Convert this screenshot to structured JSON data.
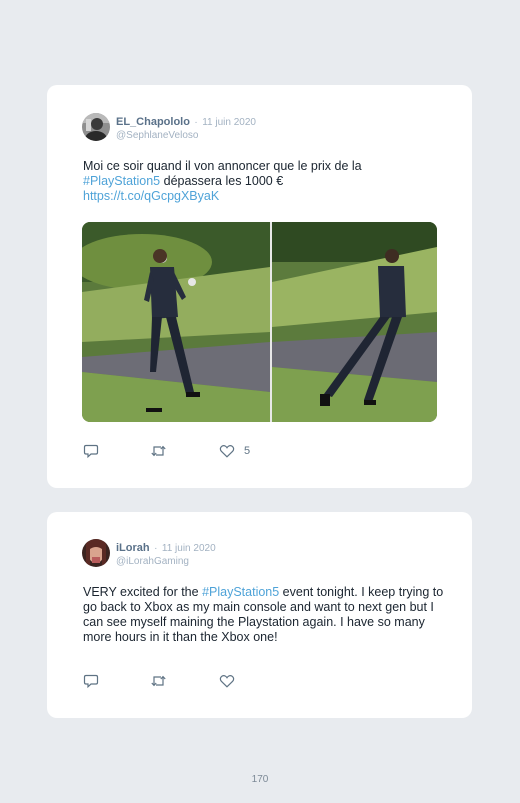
{
  "tweets": [
    {
      "name": "EL_Chapololo",
      "date": "11 juin 2020",
      "handle": "@SephlaneVeloso",
      "text_before": "Moi ce soir quand il von annoncer que le prix de la",
      "hashtag": "#PlayStation5",
      "text_after": " dépassera les 1000 €",
      "link": "https://t.co/qGcpgXByaK",
      "likes": "5",
      "avatar_icon": "user-photo",
      "media_icon": "photo-man-running"
    },
    {
      "name": "iLorah",
      "date": "11 juin 2020",
      "handle": "@iLorahGaming",
      "text_before": "VERY excited for the ",
      "hashtag": "#PlayStation5",
      "text_after": " event tonight. I keep trying to go back to Xbox as my main console and want to next gen but I can see myself maining the Playstation again. I have so many more hours in it than the Xbox one!",
      "avatar_icon": "user-photo"
    }
  ],
  "separator": "·",
  "page_number": "170",
  "colors": {
    "accent": "#4fa3d8",
    "name": "#5a7189",
    "muted": "#a3b2c2",
    "background": "#e8ebef"
  }
}
